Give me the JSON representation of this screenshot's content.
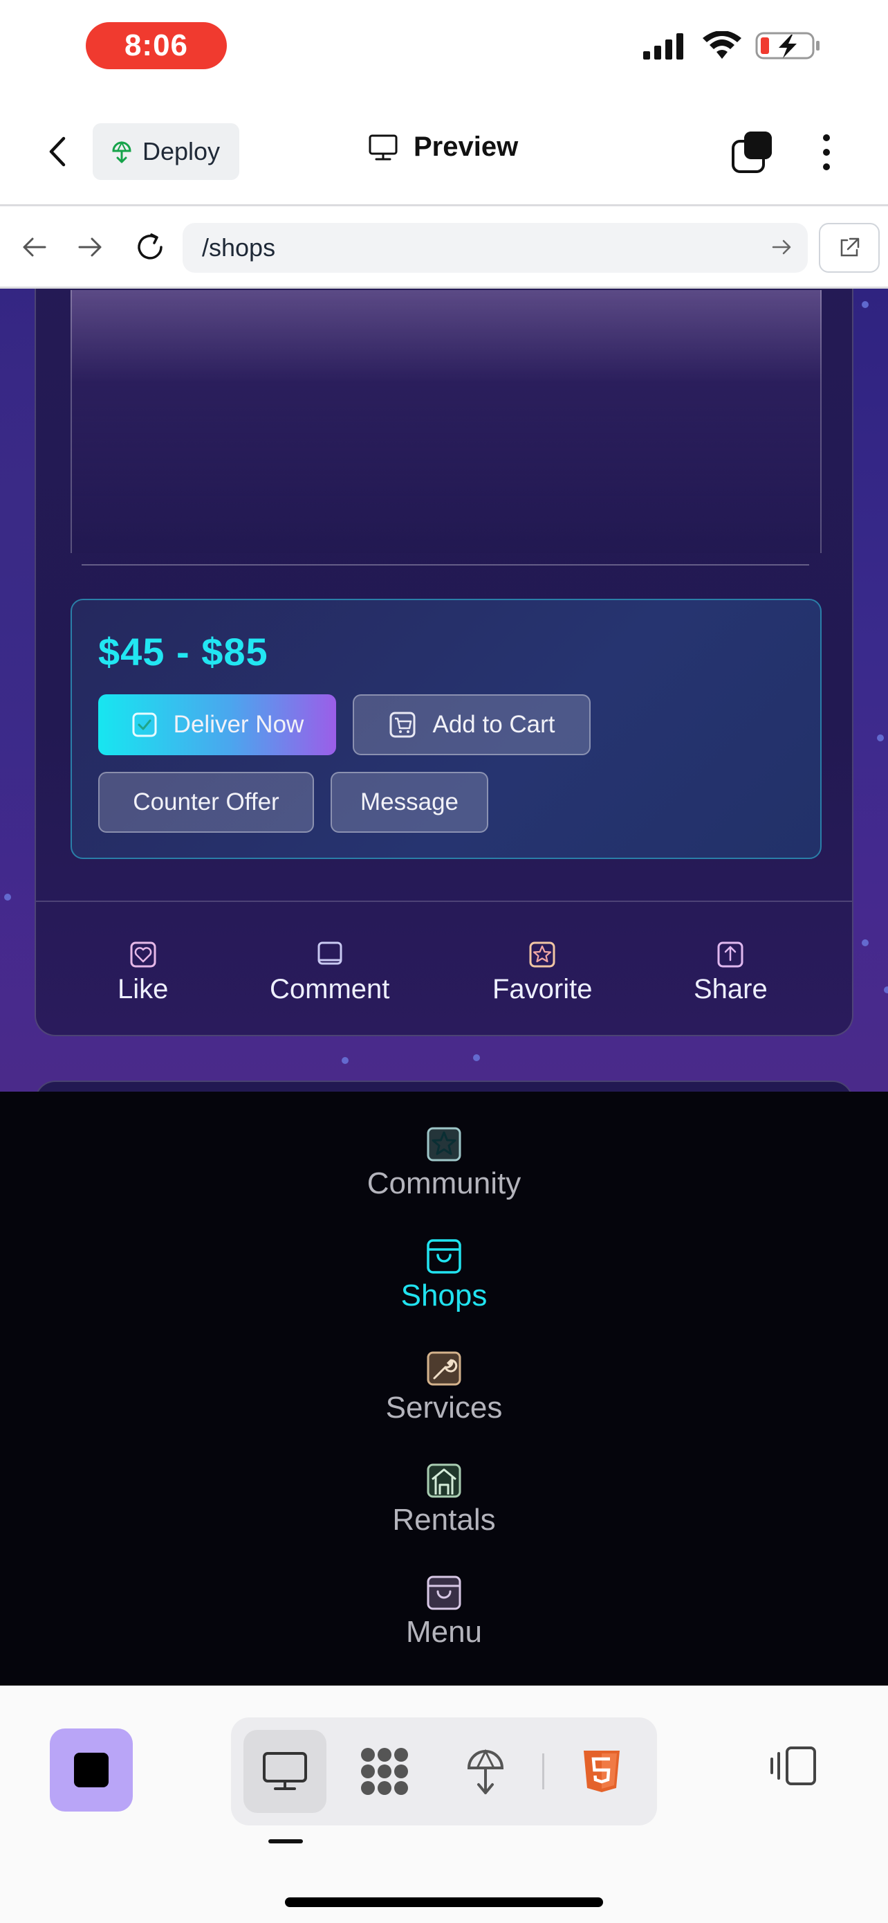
{
  "status_bar": {
    "time": "8:06"
  },
  "app_bar": {
    "deploy_label": "Deploy",
    "title": "Preview"
  },
  "browser": {
    "url": "/shops"
  },
  "product": {
    "price": "$45 - $85",
    "buttons": {
      "deliver_now": "Deliver Now",
      "add_to_cart": "Add to Cart",
      "counter_offer": "Counter Offer",
      "message": "Message"
    },
    "actions": [
      {
        "label": "Like",
        "icon": "heart-icon"
      },
      {
        "label": "Comment",
        "icon": "comment-icon"
      },
      {
        "label": "Favorite",
        "icon": "star-icon"
      },
      {
        "label": "Share",
        "icon": "share-icon"
      }
    ]
  },
  "menu": {
    "items": [
      {
        "label": "Community",
        "icon": "star-icon",
        "active": false
      },
      {
        "label": "Shops",
        "icon": "shopping-bag-icon",
        "active": true
      },
      {
        "label": "Services",
        "icon": "wrench-icon",
        "active": false
      },
      {
        "label": "Rentals",
        "icon": "house-icon",
        "active": false
      },
      {
        "label": "Menu",
        "icon": "bag-icon",
        "active": false
      }
    ]
  },
  "colors": {
    "accent": "#21e3f0",
    "time_pill": "#f03a2f",
    "stop_button": "#b9a5f7",
    "html5": "#e4622a"
  }
}
